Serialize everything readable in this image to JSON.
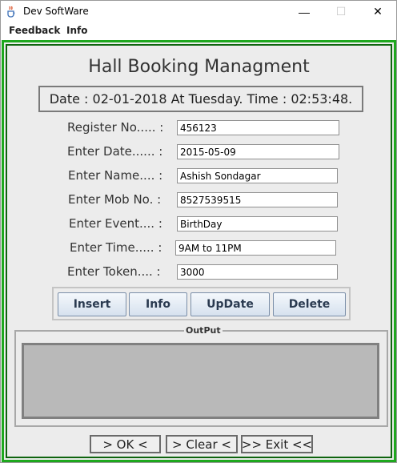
{
  "window": {
    "title": "Dev SoftWare",
    "minimize_glyph": "—",
    "maximize_glyph": "☐",
    "close_glyph": "✕"
  },
  "menu": [
    "Feedback",
    "Info"
  ],
  "page_title": "Hall Booking Managment",
  "datetime": {
    "text": "Date : 02-01-2018  At Tuesday.  Time : 02:53:48."
  },
  "form": [
    {
      "label": "Register No..... :",
      "value": "456123"
    },
    {
      "label": "Enter Date...... :",
      "value": "2015-05-09"
    },
    {
      "label": "Enter Name.... :",
      "value": "Ashish Sondagar"
    },
    {
      "label": "Enter Mob No. :",
      "value": "8527539515"
    },
    {
      "label": "Enter Event.... :",
      "value": "BirthDay"
    },
    {
      "label": "Enter Time..... :",
      "value": "9AM to 11PM"
    },
    {
      "label": "Enter Token.... :",
      "value": "3000"
    }
  ],
  "actions": [
    "Insert",
    "Info",
    "UpDate",
    "Delete"
  ],
  "output": {
    "legend": "OutPut",
    "content": ""
  },
  "bottom_buttons": [
    "> OK <",
    "> Clear <",
    ">> Exit <<"
  ],
  "colors": {
    "frame_outer": "#1ea81e",
    "frame_inner": "#0e640e",
    "panel_bg": "#ececec",
    "output_bg": "#b9b9b9"
  },
  "icons": {
    "app": "java-cup-icon"
  }
}
